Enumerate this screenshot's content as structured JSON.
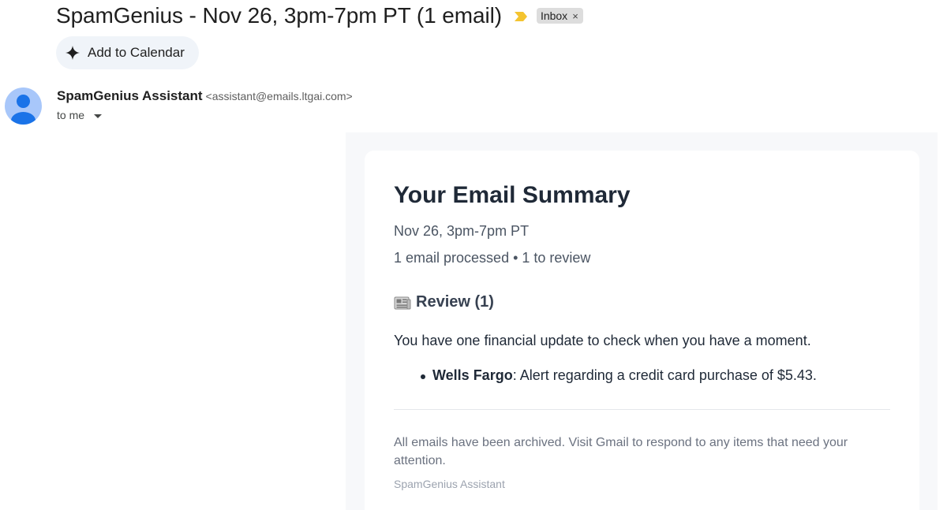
{
  "email": {
    "subject": "SpamGenius - Nov 26, 3pm-7pm PT (1 email)",
    "label": "Inbox",
    "label_remove": "×",
    "add_to_calendar": "Add to Calendar",
    "sender_name": "SpamGenius Assistant",
    "sender_email": "<assistant@emails.ltgai.com>",
    "recipient": "to me"
  },
  "summary": {
    "title": "Your Email Summary",
    "date": "Nov 26, 3pm-7pm PT",
    "stats": "1 email processed • 1 to review",
    "section_title": "Review (1)",
    "intro": "You have one financial update to check when you have a moment.",
    "items": [
      {
        "sender": "Wells Fargo",
        "text": ": Alert regarding a credit card purchase of $5.43."
      }
    ],
    "footer_note": "All emails have been archived. Visit Gmail to respond to any items that need your attention.",
    "signature": "SpamGenius Assistant"
  },
  "icons": {
    "importance": "importance-marker-icon",
    "calendar": "sparkle-icon",
    "avatar": "person-icon",
    "section": "newspaper-icon"
  },
  "colors": {
    "importance": "#f4c430",
    "chip_bg": "#dddddd",
    "avatar_bg": "#a8c7fa",
    "avatar_fg": "#1a73e8",
    "calendar_btn_bg": "#f0f4f9"
  }
}
